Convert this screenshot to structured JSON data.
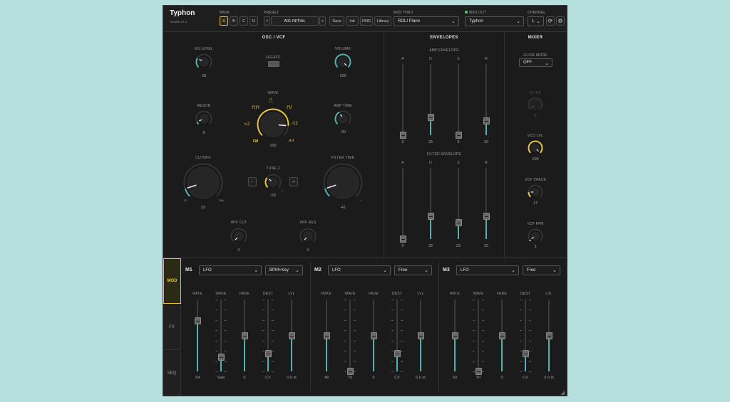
{
  "header": {
    "app_name": "Typhon",
    "app_sub": "Arcade",
    "version": "v1.0",
    "bank_label": "BANK",
    "banks": [
      "A",
      "B",
      "C",
      "D"
    ],
    "preset_label": "PRESET",
    "preset_name": "A01 INITIAL",
    "prev": "<",
    "next": ">",
    "save": "Save",
    "init": "Init",
    "rnd": "RND",
    "library": "Library",
    "midi_thru_label": "MIDI THRU",
    "midi_thru_value": "ROLI Piano",
    "midi_out_label": "MIDI OUT",
    "midi_out_value": "Typhon",
    "channel_label": "CHANNEL",
    "channel_value": "1"
  },
  "osc": {
    "title": "OSC / VCF",
    "eg_level": {
      "label": "EG LEVEL",
      "value": "28",
      "level": 0.28
    },
    "legato": {
      "label": "LEGATO"
    },
    "volume": {
      "label": "VOLUME",
      "value": "100",
      "level": 1.0
    },
    "reson": {
      "label": "RESON",
      "value": "8",
      "level": 0.08
    },
    "wave": {
      "label": "WAVE",
      "value": "100",
      "level": 0.85,
      "fm": "FM",
      "left_num": "2",
      "right_num": "12"
    },
    "amp_time": {
      "label": "AMP TIME",
      "value": "-30",
      "level": 0.4
    },
    "cutoff": {
      "label": "CUTOFF",
      "value": "33",
      "level": 0.1,
      "min": "20",
      "max": "20k"
    },
    "tune2": {
      "label": "TUNE 2",
      "value": "-63",
      "level": 0.3,
      "minus": "-",
      "plus": "+",
      "min": "-",
      "max": "+"
    },
    "filter_time": {
      "label": "FILTER TIME",
      "value": "-41",
      "level": 0.1,
      "min": "-",
      "max": "+"
    },
    "hpf_cut": {
      "label": "HPF CUT",
      "value": "0",
      "level": 0.0
    },
    "hpf_res": {
      "label": "HPF RES",
      "value": "0",
      "level": 0.0
    }
  },
  "envelopes": {
    "title": "ENVELOPES",
    "amp_title": "AMP ENVELOPE",
    "amp": [
      {
        "label": "A",
        "value": "0",
        "level": 0.0
      },
      {
        "label": "D",
        "value": "25",
        "level": 0.25
      },
      {
        "label": "S",
        "value": "0",
        "level": 0.0
      },
      {
        "label": "R",
        "value": "20",
        "level": 0.2
      }
    ],
    "filter_title": "FILTER ENVELOPE",
    "filter": [
      {
        "label": "A",
        "value": "0",
        "level": 0.0
      },
      {
        "label": "D",
        "value": "32",
        "level": 0.32
      },
      {
        "label": "S",
        "value": "23",
        "level": 0.23
      },
      {
        "label": "R",
        "value": "32",
        "level": 0.32
      }
    ]
  },
  "mixer": {
    "title": "MIXER",
    "glide_mode_label": "GLIDE MODE",
    "glide_mode_value": "OFF",
    "glide": {
      "label": "GLIDE",
      "value": "0",
      "level": 0.0
    },
    "vco_lvl": {
      "label": "VCO LVL",
      "value": "100",
      "level": 1.0
    },
    "vcf_track": {
      "label": "VCF TRACK",
      "value": "17",
      "level": 0.17
    },
    "vcf_ffm": {
      "label": "VCF FFM",
      "value": "3",
      "level": 0.05
    }
  },
  "side_tabs": [
    "MOD",
    "FX",
    "SEQ"
  ],
  "mods": [
    {
      "name": "M1",
      "type": "LFO",
      "sync": "BPM+Key",
      "sliders": [
        {
          "label": "RATE",
          "value": "X4",
          "level": 0.7
        },
        {
          "label": "WAVE",
          "value": "Saw",
          "level": 0.2
        },
        {
          "label": "FADE",
          "value": "0",
          "level": 0.5
        },
        {
          "label": "DEST",
          "value": "CV",
          "level": 0.25
        },
        {
          "label": "LVL",
          "value": "0.0 st",
          "level": 0.5
        }
      ]
    },
    {
      "name": "M2",
      "type": "LFO",
      "sync": "Free",
      "sliders": [
        {
          "label": "RATE",
          "value": "48",
          "level": 0.5
        },
        {
          "label": "WAVE",
          "value": "Tri",
          "level": 0.0
        },
        {
          "label": "FADE",
          "value": "0",
          "level": 0.5
        },
        {
          "label": "DEST",
          "value": "CV",
          "level": 0.25
        },
        {
          "label": "LVL",
          "value": "0.0 st",
          "level": 0.5
        }
      ]
    },
    {
      "name": "M3",
      "type": "LFO",
      "sync": "Free",
      "sliders": [
        {
          "label": "RATE",
          "value": "50",
          "level": 0.5
        },
        {
          "label": "WAVE",
          "value": "Tri",
          "level": 0.0
        },
        {
          "label": "FADE",
          "value": "0",
          "level": 0.5
        },
        {
          "label": "DEST",
          "value": "CV",
          "level": 0.25
        },
        {
          "label": "LVL",
          "value": "0.0 st",
          "level": 0.5
        }
      ]
    }
  ],
  "colors": {
    "accent_yellow": "#e6c73c",
    "accent_teal": "#4fb3b1",
    "panel": "#1b1b1b"
  }
}
